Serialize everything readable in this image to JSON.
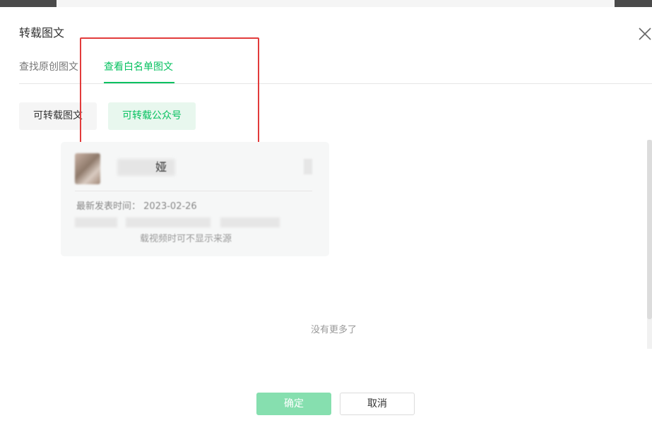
{
  "dialog": {
    "title": "转载图文",
    "close_icon": "close-icon"
  },
  "tabs": [
    {
      "label": "查找原创图文",
      "active": false
    },
    {
      "label": "查看白名单图文",
      "active": true
    }
  ],
  "filters": [
    {
      "label": "可转载图文",
      "selected": false
    },
    {
      "label": "可转载公众号",
      "selected": true
    }
  ],
  "account_card": {
    "name": "娅",
    "latest_label": "最新发表时间：",
    "latest_date": "2023-02-26",
    "note": "载视频时可不显示来源"
  },
  "list_end_text": "没有更多了",
  "buttons": {
    "confirm": "确定",
    "cancel": "取消"
  },
  "colors": {
    "accent": "#07c160",
    "highlight_box": "#e23b3b"
  }
}
